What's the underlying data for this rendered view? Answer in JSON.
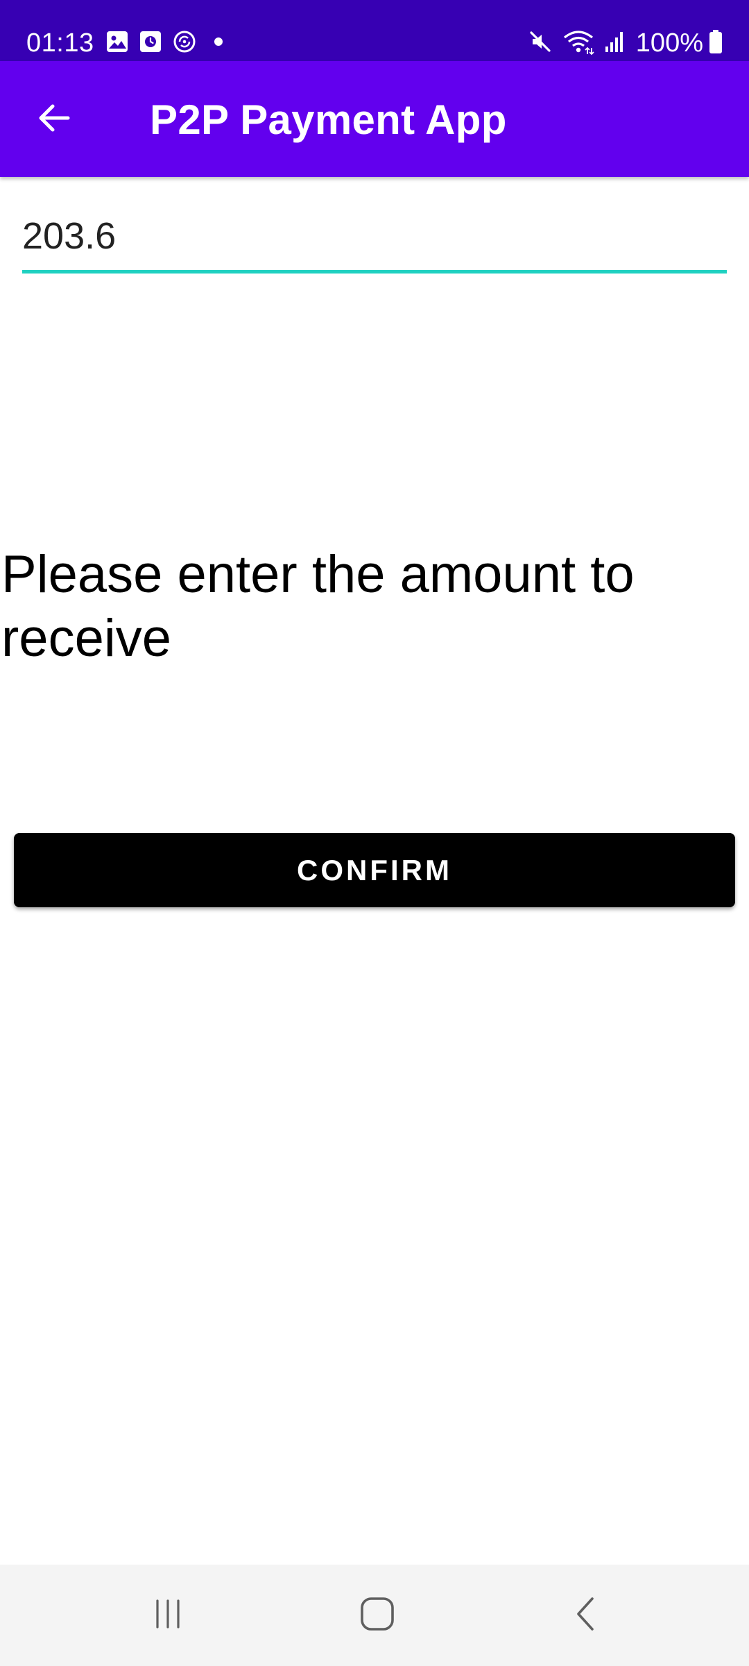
{
  "status_bar": {
    "time": "01:13",
    "battery": "100%",
    "left_icons": [
      "gallery-icon",
      "screen-time-icon",
      "sync-icon",
      "dot-icon"
    ],
    "right_icons": [
      "mute-icon",
      "wifi-icon",
      "signal-icon",
      "battery-icon"
    ],
    "background": "#3700b3"
  },
  "app_bar": {
    "title": "P2P Payment App",
    "background": "#6200ee",
    "back_icon": "arrow-back-icon"
  },
  "amount_field": {
    "value": "203.6",
    "underline_color": "#1fd1c1"
  },
  "prompt": {
    "text": "Please enter the amount to receive"
  },
  "confirm_button": {
    "label": "CONFIRM",
    "background": "#000000"
  },
  "nav_bar": {
    "items": [
      "recents-icon",
      "home-icon",
      "back-icon"
    ]
  }
}
